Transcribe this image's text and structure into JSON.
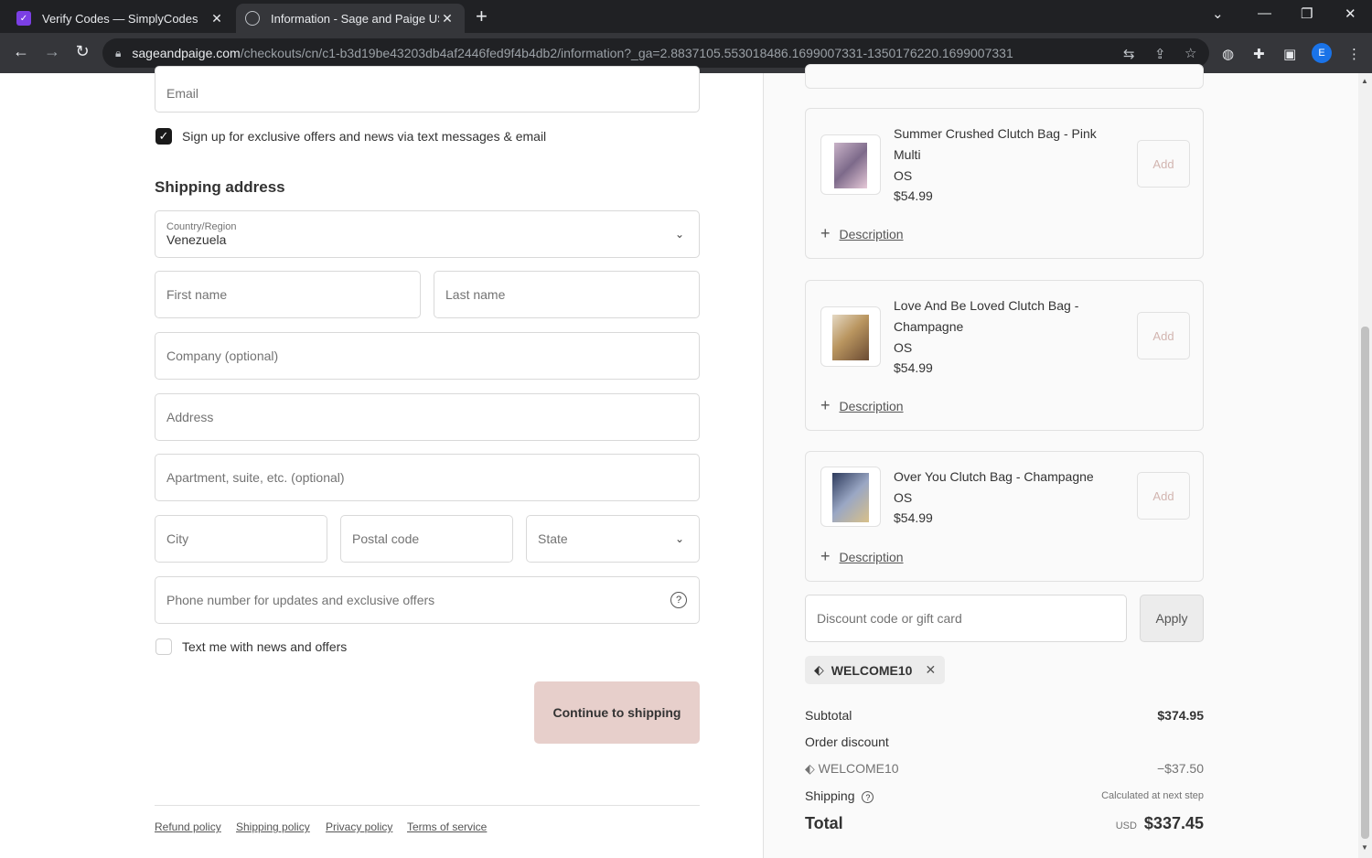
{
  "browser": {
    "tabs": [
      {
        "title": "Verify Codes — SimplyCodes",
        "close": "✕"
      },
      {
        "title": "Information - Sage and Paige US",
        "close": "✕"
      }
    ],
    "new_tab": "+",
    "url_host": "sageandpaige.com",
    "url_path": "/checkouts/cn/c1-b3d19be43203db4af2446fed9f4b4db2/information?_ga=2.8837105.553018486.1699007331-1350176220.1699007331",
    "profile_initial": "E"
  },
  "form": {
    "email_placeholder": "Email",
    "signup_label": "Sign up for exclusive offers and news via text messages & email",
    "shipping_heading": "Shipping address",
    "country_label": "Country/Region",
    "country_value": "Venezuela",
    "first_name": "First name",
    "last_name": "Last name",
    "company": "Company (optional)",
    "address": "Address",
    "apartment": "Apartment, suite, etc. (optional)",
    "city": "City",
    "postal": "Postal code",
    "state": "State",
    "phone": "Phone number for updates and exclusive offers",
    "text_me_label": "Text me with news and offers",
    "continue_button": "Continue to shipping"
  },
  "footer": {
    "links": [
      "Refund policy",
      "Shipping policy",
      "Privacy policy",
      "Terms of service"
    ]
  },
  "products": [
    {
      "name": "Summer Crushed Clutch Bag - Pink Multi",
      "size": "OS",
      "price": "$54.99",
      "add": "Add",
      "description": "Description"
    },
    {
      "name": "Love And Be Loved Clutch Bag - Champagne",
      "size": "OS",
      "price": "$54.99",
      "add": "Add",
      "description": "Description"
    },
    {
      "name": "Over You Clutch Bag - Champagne",
      "size": "OS",
      "price": "$54.99",
      "add": "Add",
      "description": "Description"
    }
  ],
  "discount": {
    "placeholder": "Discount code or gift card",
    "apply": "Apply",
    "applied_code": "WELCOME10"
  },
  "summary": {
    "subtotal_label": "Subtotal",
    "subtotal_value": "$374.95",
    "order_discount_label": "Order discount",
    "discount_code": "WELCOME10",
    "discount_value": "−$37.50",
    "shipping_label": "Shipping",
    "shipping_value": "Calculated at next step",
    "total_label": "Total",
    "currency": "USD",
    "total_value": "$337.45"
  },
  "colors": {
    "accent_button": "#e7cfcb",
    "checkbox": "#1a1a1a"
  }
}
